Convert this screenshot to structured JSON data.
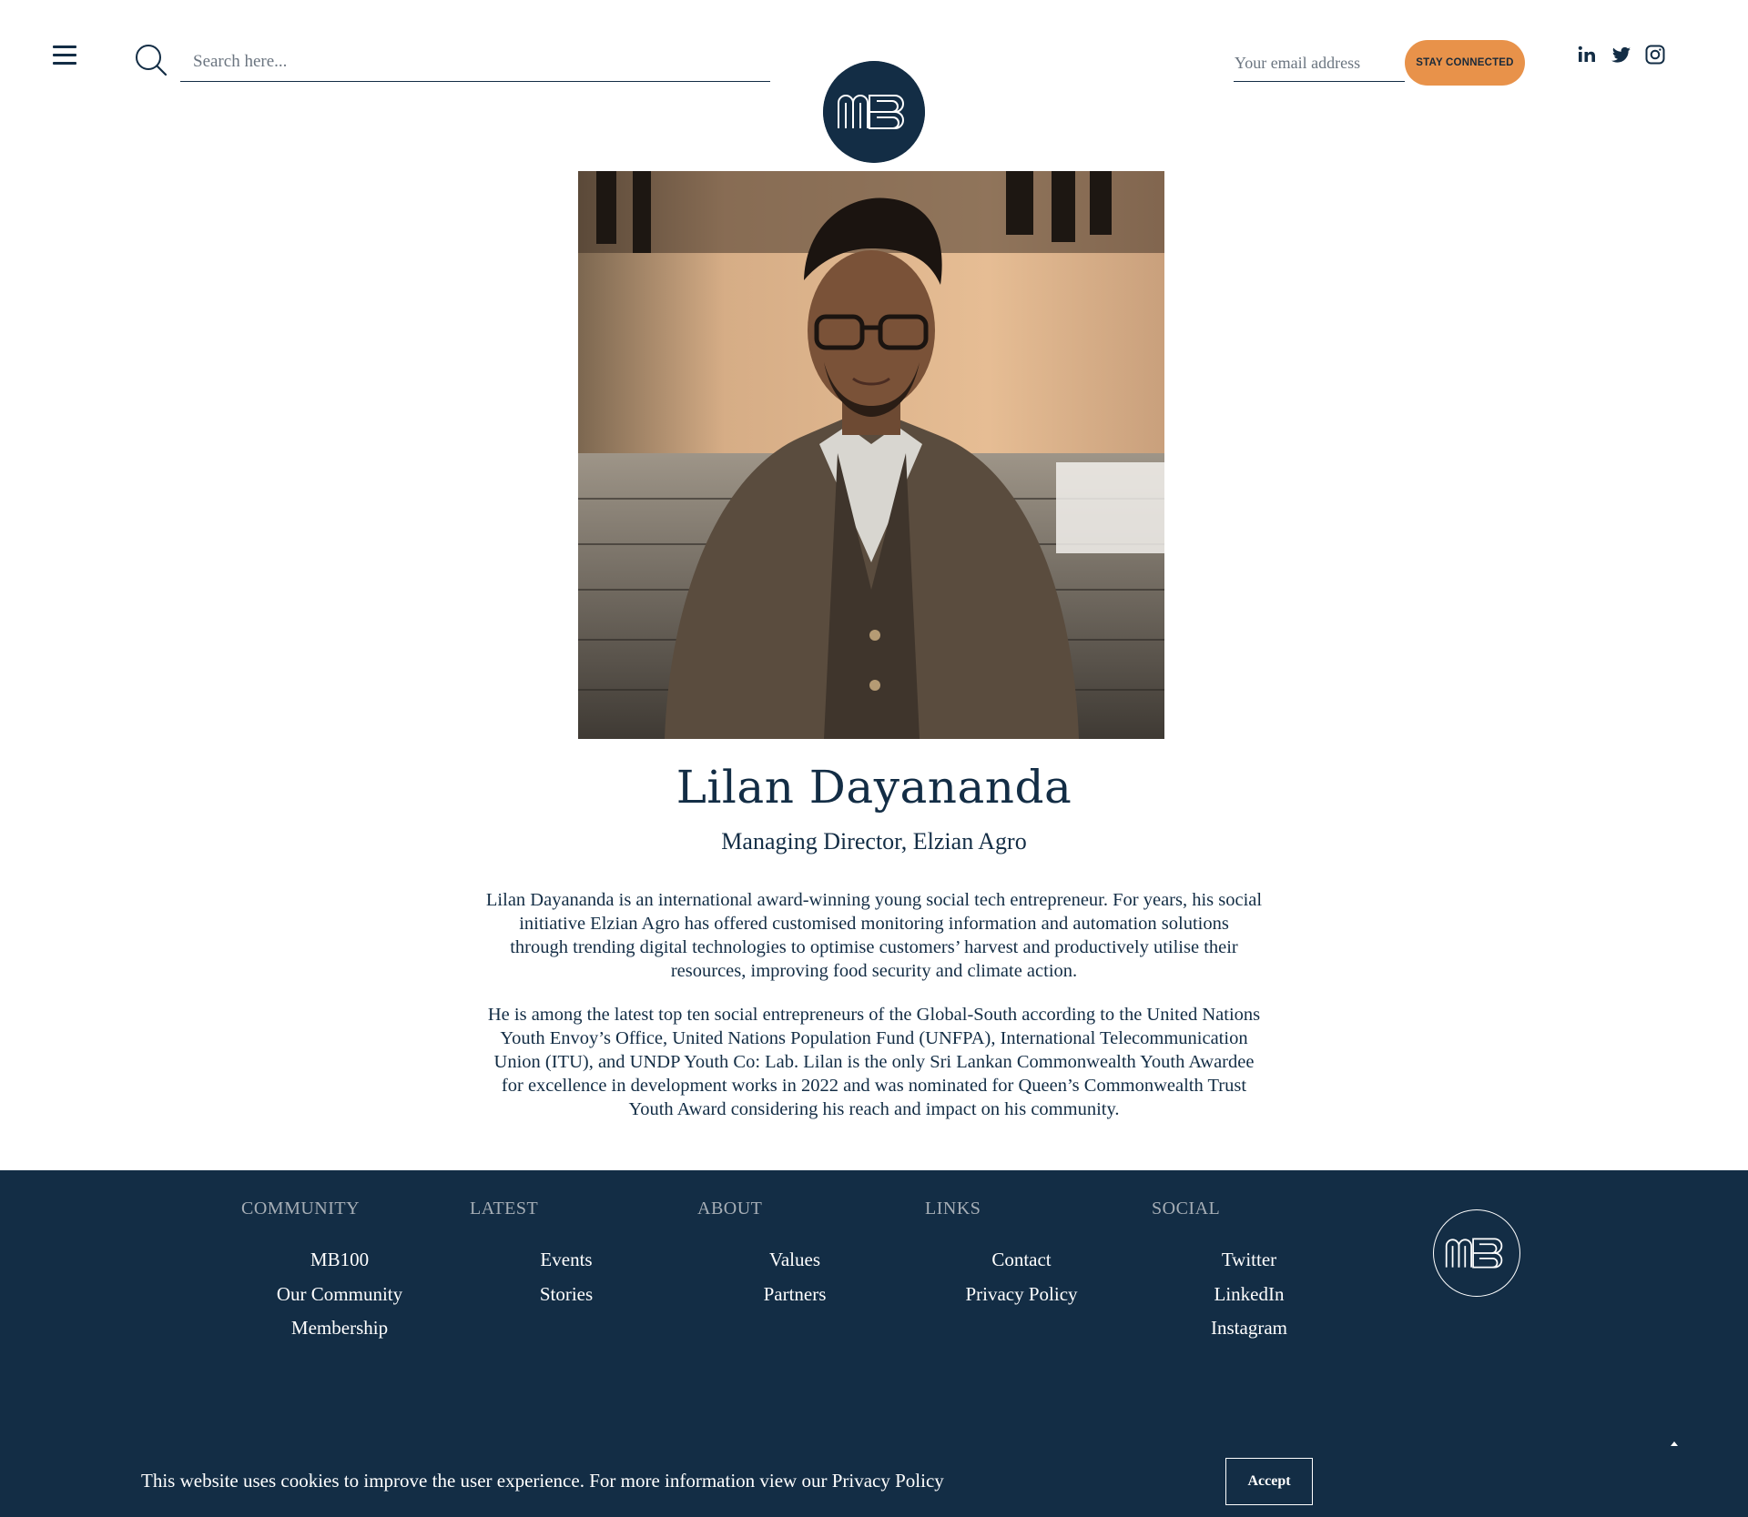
{
  "header": {
    "menu_icon": "hamburger-icon",
    "search_icon": "search-icon",
    "search_placeholder": "Search here...",
    "email_placeholder": "Your email address",
    "stay_connected_label": "STAY CONNECTED",
    "social_icons": [
      "linkedin-icon",
      "twitter-icon",
      "instagram-icon"
    ]
  },
  "logo": {
    "text": "MB"
  },
  "profile": {
    "name": "Lilan Dayananda",
    "role": "Managing Director, Elzian Agro",
    "bio_1_lines": [
      "Lilan Dayananda is an international award-winning young social tech entrepreneur. For years, his social",
      "initiative Elzian Agro has offered customised monitoring information and automation solutions",
      "through trending digital technologies to optimise customers’ harvest and productively utilise their",
      "resources, improving food security and climate action."
    ],
    "bio_2_lines": [
      "He is among the latest top ten social entrepreneurs of the Global-South according to the United Nations",
      "Youth Envoy’s Office, United Nations Population Fund (UNFPA), International Telecommunication",
      "Union (ITU), and UNDP Youth Co: Lab. Lilan is the only Sri Lankan Commonwealth Youth Awardee",
      "for excellence in development works in 2022 and was nominated for Queen’s Commonwealth Trust",
      "Youth Award considering his reach and impact on his community."
    ]
  },
  "footer": {
    "columns": [
      {
        "heading": "COMMUNITY",
        "links": [
          "MB100",
          "Our Community",
          "Membership"
        ]
      },
      {
        "heading": "LATEST",
        "links": [
          "Events",
          "Stories"
        ]
      },
      {
        "heading": "ABOUT",
        "links": [
          "Values",
          "Partners"
        ]
      },
      {
        "heading": "LINKS",
        "links": [
          "Contact",
          "Privacy Policy"
        ]
      },
      {
        "heading": "SOCIAL",
        "links": [
          "Twitter",
          "LinkedIn",
          "Instagram"
        ]
      }
    ],
    "back_to_top_icon": "caret-up-icon"
  },
  "cookie": {
    "message": "This website uses cookies to improve the user experience. For more information view our Privacy Policy",
    "accept_label": "Accept"
  },
  "colors": {
    "navy": "#132d45",
    "accent": "#e8924a",
    "muted": "#a6aeb6"
  }
}
